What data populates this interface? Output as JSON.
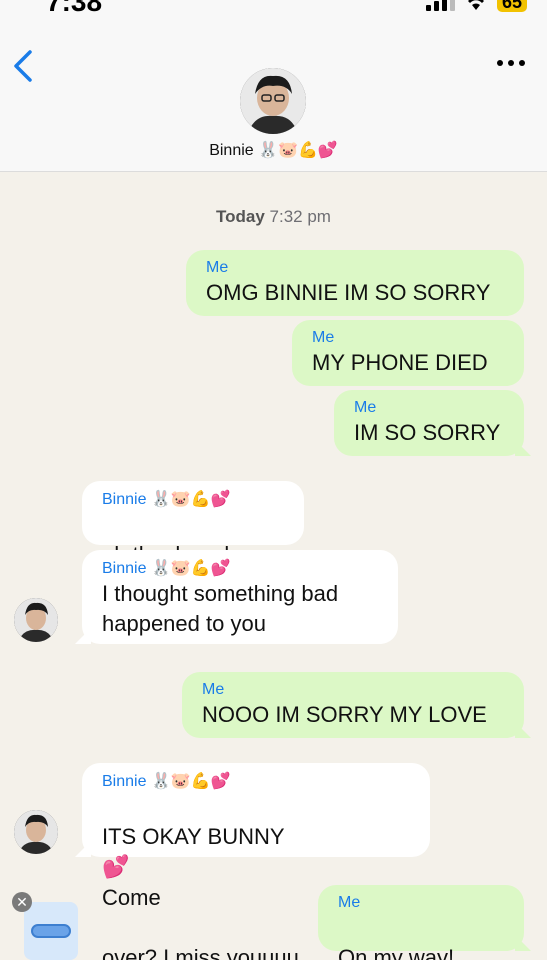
{
  "status": {
    "time": "7:38",
    "battery": "65"
  },
  "header": {
    "contact_name": "Binnie",
    "contact_emoji": "🐰🐷💪💕"
  },
  "date": {
    "day": "Today",
    "time": "7:32 pm"
  },
  "messages": [
    {
      "sender": "Me",
      "text": "OMG BINNIE IM SO SORRY"
    },
    {
      "sender": "Me",
      "text": "MY PHONE DIED"
    },
    {
      "sender": "Me",
      "text": "IM SO SORRY"
    },
    {
      "sender": "Binnie",
      "sender_emoji": "🐰🐷💪💕",
      "text": "oh thank god",
      "text_emoji": "😞"
    },
    {
      "sender": "Binnie",
      "sender_emoji": "🐰🐷💪💕",
      "text": "I thought something bad\nhappened to you"
    },
    {
      "sender": "Me",
      "text": "NOOO IM SORRY MY LOVE"
    },
    {
      "sender": "Binnie",
      "sender_emoji": "🐰🐷💪💕",
      "text_line1": "ITS OKAY BUNNY",
      "text_emoji1": "💕",
      "text_line1b": "Come",
      "text_line2": "over? I miss youuuu",
      "text_emoji2": "😞"
    },
    {
      "sender": "Me",
      "text": "On my way!",
      "text_emoji": "💗"
    }
  ],
  "colors": {
    "me_bubble": "#dcf8c6",
    "them_bubble": "#ffffff",
    "sender_name": "#1a7ce8",
    "background": "#f4f1ea"
  },
  "icons": {
    "back": "chevron-left-icon",
    "more": "ellipsis-icon",
    "close": "close-icon"
  }
}
